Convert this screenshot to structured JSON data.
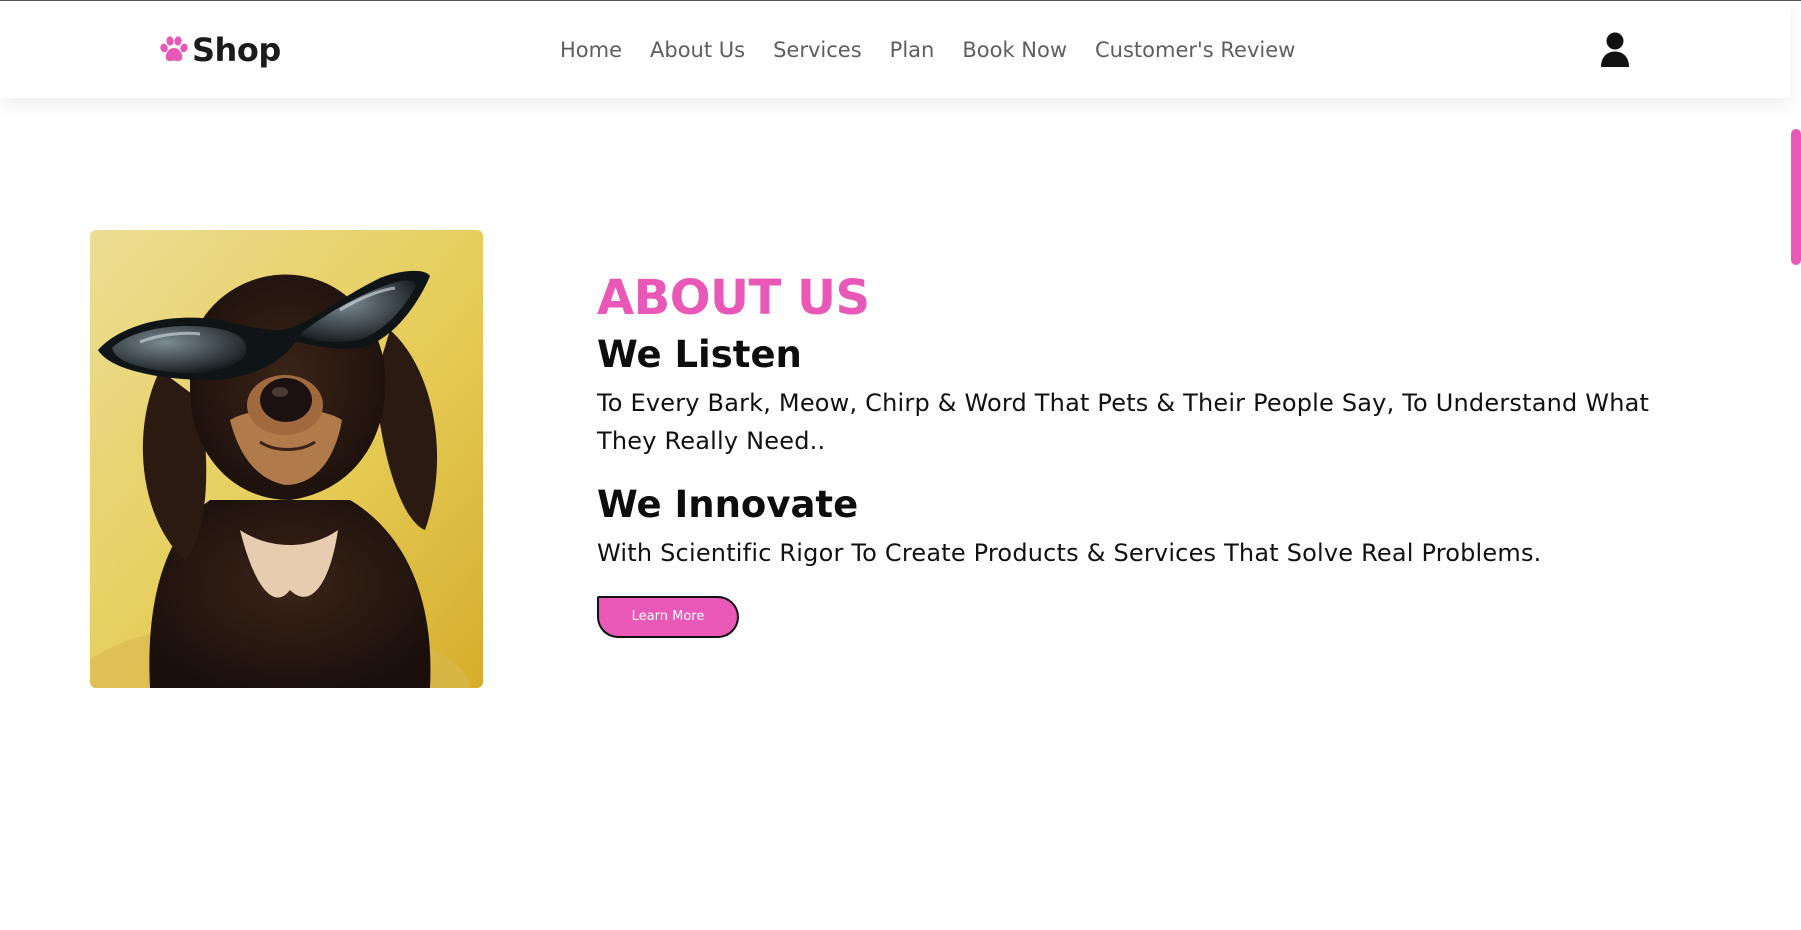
{
  "brand": {
    "name": "Shop",
    "icon": "paw-icon",
    "accent_color": "#e957b7"
  },
  "nav": {
    "items": [
      {
        "label": "Home"
      },
      {
        "label": "About Us"
      },
      {
        "label": "Services"
      },
      {
        "label": "Plan"
      },
      {
        "label": "Book Now"
      },
      {
        "label": "Customer's Review"
      }
    ],
    "user_icon": "user-icon"
  },
  "about": {
    "title": "ABOUT US",
    "image_icon": "dog-with-sunglasses-photo",
    "sections": [
      {
        "heading": "We Listen",
        "text": "To Every Bark, Meow, Chirp & Word That Pets & Their People Say, To Understand What They Really Need.."
      },
      {
        "heading": "We Innovate",
        "text": "With Scientific Rigor To Create Products & Services That Solve Real Problems."
      }
    ],
    "button_label": "Learn More"
  }
}
